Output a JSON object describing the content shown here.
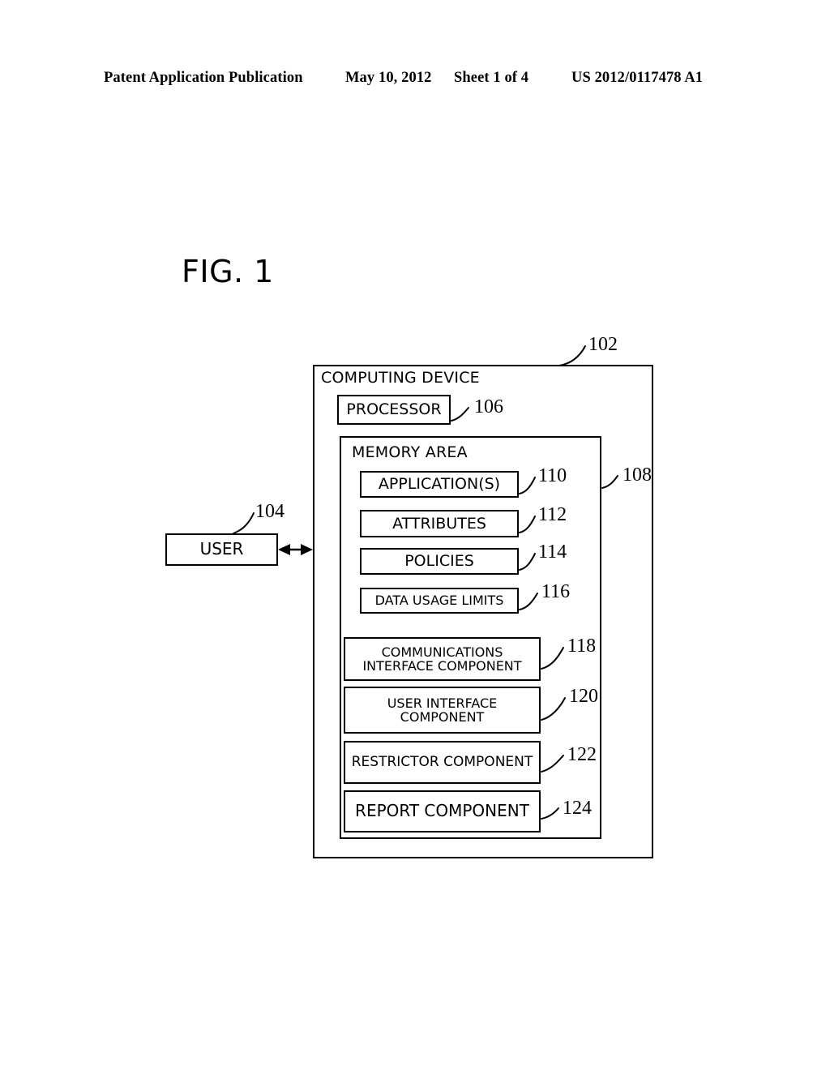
{
  "header": {
    "publication": "Patent Application Publication",
    "date": "May 10, 2012",
    "sheet": "Sheet 1 of 4",
    "publication_number": "US 2012/0117478 A1"
  },
  "figure": {
    "label": "FIG. 1",
    "type": "block-diagram"
  },
  "diagram": {
    "computing_device": {
      "title": "COMPUTING DEVICE",
      "ref": "102"
    },
    "user": {
      "label": "USER",
      "ref": "104"
    },
    "processor": {
      "label": "PROCESSOR",
      "ref": "106"
    },
    "memory_area": {
      "title": "MEMORY AREA",
      "ref": "108"
    },
    "memory_items": [
      {
        "label": "APPLICATION(S)",
        "ref": "110"
      },
      {
        "label": "ATTRIBUTES",
        "ref": "112"
      },
      {
        "label": "POLICIES",
        "ref": "114"
      },
      {
        "label": "DATA USAGE LIMITS",
        "ref": "116"
      }
    ],
    "components": [
      {
        "line1": "COMMUNICATIONS",
        "line2": "INTERFACE COMPONENT",
        "ref": "118"
      },
      {
        "line1": "USER INTERFACE",
        "line2": "COMPONENT",
        "ref": "120"
      },
      {
        "line1": "RESTRICTOR COMPONENT",
        "line2": "",
        "ref": "122"
      },
      {
        "line1": "REPORT COMPONENT",
        "line2": "",
        "ref": "124"
      }
    ],
    "connections": [
      {
        "from": "user",
        "to": "computing_device",
        "style": "double-arrow"
      }
    ],
    "colors": {
      "stroke": "#000000",
      "background": "#ffffff"
    }
  }
}
